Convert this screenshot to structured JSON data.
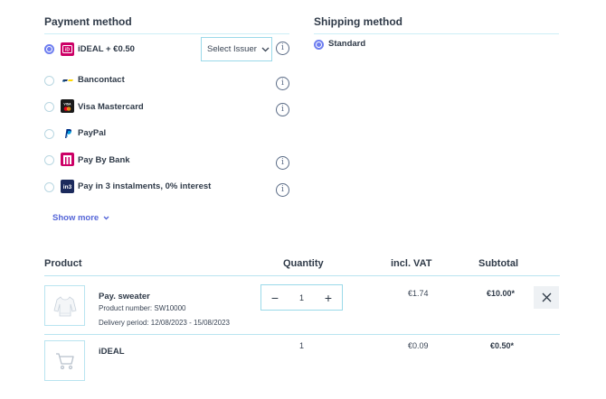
{
  "payment": {
    "title": "Payment method",
    "methods": [
      {
        "label": "iDEAL + €0.50",
        "logo": "ideal-logo",
        "logo_text": "iD",
        "logo_color": "#cc0066",
        "selected": true
      },
      {
        "label": "Bancontact",
        "logo": "bancontact-logo",
        "logo_text": "",
        "logo_color": "#ffffff",
        "selected": false
      },
      {
        "label": "Visa Mastercard",
        "logo": "visa-mastercard-logo",
        "logo_text": "VISA",
        "logo_color": "#1a1a1a",
        "selected": false
      },
      {
        "label": "PayPal",
        "logo": "paypal-logo",
        "logo_text": "P",
        "logo_color": "#ffffff",
        "selected": false
      },
      {
        "label": "Pay By Bank",
        "logo": "pay-by-bank-logo",
        "logo_text": "",
        "logo_color": "#cc0066",
        "selected": false
      },
      {
        "label": "Pay in 3 instalments, 0% interest",
        "logo": "in3-logo",
        "logo_text": "in3",
        "logo_color": "#1b2a5c",
        "selected": false
      }
    ],
    "issuer_select": {
      "value": "Select Issuer"
    },
    "show_more": "Show more"
  },
  "shipping": {
    "title": "Shipping method",
    "options": [
      {
        "label": "Standard",
        "selected": true
      }
    ]
  },
  "cart": {
    "headers": {
      "product": "Product",
      "quantity": "Quantity",
      "incl_vat": "incl. VAT",
      "subtotal": "Subtotal"
    },
    "items": [
      {
        "name": "Pay. sweater",
        "product_number": "Product number: SW10000",
        "delivery": "Delivery period: 12/08/2023 - 15/08/2023",
        "quantity": "1",
        "incl_vat": "€1.74",
        "subtotal": "€10.00*"
      },
      {
        "name": "iDEAL",
        "quantity": "1",
        "incl_vat": "€0.09",
        "subtotal": "€0.50*"
      }
    ]
  },
  "colors": {
    "accent": "#6f7ff0",
    "link": "#5566d8",
    "rule": "#cdeef6",
    "border": "#9ad9e9"
  }
}
